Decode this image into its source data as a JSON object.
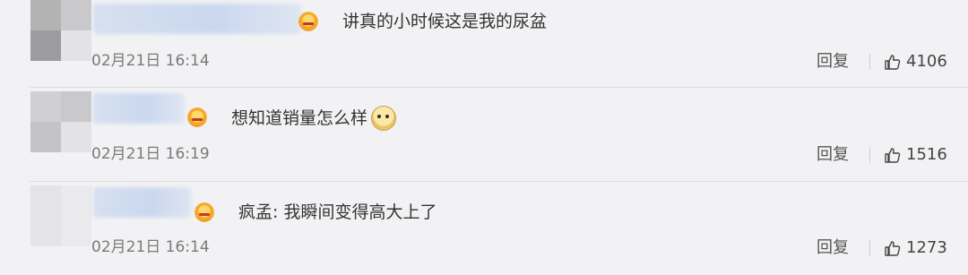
{
  "comments": [
    {
      "text": "讲真的小时候这是我的尿盆",
      "time": "02月21日 16:14",
      "reply_label": "回复",
      "likes": "4106",
      "icon": "vip-crown-icon"
    },
    {
      "text": "想知道销量怎么样",
      "time": "02月21日 16:19",
      "reply_label": "回复",
      "likes": "1516",
      "icon": "vip-crown-icon",
      "emoji": "doge-emoji-icon"
    },
    {
      "text": "疯孟: 我瞬间变得高大上了",
      "time": "02月21日 16:14",
      "reply_label": "回复",
      "likes": "1273",
      "icon": "vip-crown-icon"
    }
  ],
  "colors": {
    "background": "#f2f2f4",
    "text": "#333333",
    "meta": "#7a7a7a",
    "divider": "#dedede"
  }
}
